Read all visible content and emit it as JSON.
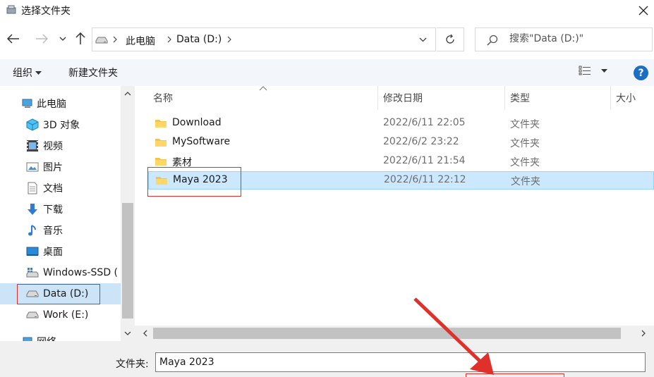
{
  "window": {
    "title": "选择文件夹"
  },
  "address": {
    "crumbs": [
      "此电脑",
      "Data (D:)"
    ]
  },
  "search": {
    "placeholder": "搜索\"Data (D:)\""
  },
  "toolbar": {
    "organize_label": "组织",
    "newfolder_label": "新建文件夹",
    "help_label": "?"
  },
  "sidebar": {
    "partial_top_label": "",
    "items": [
      {
        "label": "此电脑",
        "icon": "computer-icon"
      },
      {
        "label": "3D 对象",
        "icon": "cube-icon"
      },
      {
        "label": "视频",
        "icon": "video-icon"
      },
      {
        "label": "图片",
        "icon": "picture-icon"
      },
      {
        "label": "文档",
        "icon": "document-icon"
      },
      {
        "label": "下载",
        "icon": "download-icon"
      },
      {
        "label": "音乐",
        "icon": "music-icon"
      },
      {
        "label": "桌面",
        "icon": "desktop-icon"
      },
      {
        "label": "Windows-SSD (",
        "icon": "windows-drive-icon"
      },
      {
        "label": "Data (D:)",
        "icon": "drive-icon",
        "selected": true
      },
      {
        "label": "Work (E:)",
        "icon": "drive-icon"
      },
      {
        "label": "网络",
        "icon": "network-icon"
      }
    ]
  },
  "columns": {
    "name": "名称",
    "modified": "修改日期",
    "type": "类型",
    "size": "大小"
  },
  "files": [
    {
      "name": "Download",
      "modified": "2022/6/11 22:05",
      "type": "文件夹"
    },
    {
      "name": "MySoftware",
      "modified": "2022/6/2 23:22",
      "type": "文件夹"
    },
    {
      "name": "素材",
      "modified": "2022/6/11 21:54",
      "type": "文件夹"
    },
    {
      "name": "Maya 2023",
      "modified": "2022/6/11 22:12",
      "type": "文件夹",
      "selected": true
    }
  ],
  "footer": {
    "folder_label": "文件夹:",
    "folder_value": "Maya 2023"
  },
  "colors": {
    "accent": "#1b6ec2",
    "selection": "#cce8ff",
    "annotation": "#e0302b"
  }
}
